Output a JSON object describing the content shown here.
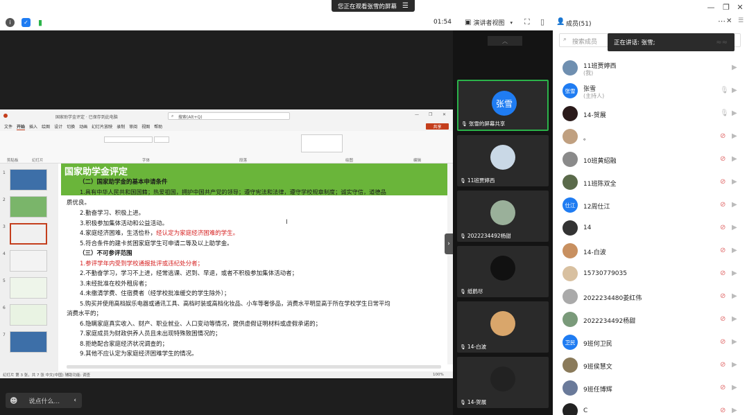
{
  "banner": {
    "text": "您正在观看张雪的屏幕",
    "menu_icon": "menu-icon"
  },
  "toolbar": {
    "time": "01:54",
    "view_label": "演讲者视图",
    "members_label": "成员(51)",
    "search_placeholder": "搜索成员"
  },
  "speaking": {
    "text": "正在讲话: 张雪;"
  },
  "chat": {
    "placeholder": "说点什么..."
  },
  "gallery": [
    {
      "name": "张雪的屏幕共享",
      "avatar_text": "张雪",
      "color": "#1f7cf2",
      "highlight": true
    },
    {
      "name": "11班贾婷西"
    },
    {
      "name": "2022234492杨甜"
    },
    {
      "name": "纸鹤尽"
    },
    {
      "name": "14-白波"
    },
    {
      "name": "14-贺展"
    }
  ],
  "ppt": {
    "doc_title": "国家助学金评定 · 已保存到此电脑",
    "search": "搜索(Alt+Q)",
    "share_btn": "共享",
    "tabs": [
      "文件",
      "开始",
      "插入",
      "绘图",
      "设计",
      "切换",
      "动画",
      "幻灯片放映",
      "录制",
      "审阅",
      "视图",
      "帮助"
    ],
    "groups": [
      "剪贴板",
      "幻灯片",
      "字体",
      "段落",
      "绘图",
      "编辑"
    ],
    "slide_title": "国家助学金评定",
    "sec1": "（二）国家助学金的基本申请条件",
    "l1a": "1.具有中华人民共和国国籍；热爱祖国，拥护中国共产党的领导；遵守宪法和法律，遵守学校规章制度；诚实守信，道德品",
    "l1b": "质优良。",
    "l2": "2.勤奋学习、积极上进。",
    "l3": "3.积极参加集体活动和公益活动。",
    "l4a": "4.家庭经济困难，生活俭朴，",
    "l4b": "经认定为家庭经济困难的学生。",
    "l5": "5.符合条件的建卡贫困家庭学生可申请二等及以上助学金。",
    "sec2": "（三）不可参评范围",
    "n1": "1.参评学年内受到学校通报批评或违纪处分者；",
    "n2": "2.不勤奋学习，学习不上进，经常逃课、迟到、早退，或者不积极参加集体活动者；",
    "n3": "3.未经批准在校外租房者；",
    "n4": "4.未缴清学费、住宿费者（经学校批准缓交的学生除外）；",
    "n5a": "5.购买并使用高档娱乐电器或通讯工具、高档时装或高档化妆品、小车等奢侈品，消费水平明显高于所在学校学生日常平均",
    "n5b": "消费水平的；",
    "n6": "6.隐瞒家庭真实收入、财产、职业就业、人口变动等情况，提供虚假证明材料或虚假承诺的；",
    "n7": "7.家庭成员为财政供养人员且未出现特殊致困情况的；",
    "n8": "8.拒绝配合家庭经济状况调查的；",
    "n9": "9.其他不应认定为家庭经济困难学生的情况。",
    "status": "幻灯片 第 3 张，共 7 张    中文(中国)    辅助功能: 调查",
    "zoom": "100%",
    "thumb_nums": [
      "1",
      "2",
      "3",
      "4",
      "5",
      "6",
      "7"
    ]
  },
  "members": [
    {
      "name": "11班贾婷西",
      "sub": "(我)",
      "avatar": "",
      "color": "#6f8fb0",
      "mic": "none"
    },
    {
      "name": "张雪",
      "sub": "(主持人)",
      "avatar": "张雪",
      "color": "#1f7cf2",
      "mic": "on"
    },
    {
      "name": "14-贺展",
      "sub": "",
      "avatar": "",
      "color": "#2a1a1a",
      "mic": "on"
    },
    {
      "name": "。",
      "sub": "",
      "avatar": "",
      "color": "#c0a080",
      "mic": "off"
    },
    {
      "name": "10班黄绍融",
      "sub": "",
      "avatar": "",
      "color": "#8a8a8a",
      "mic": "off"
    },
    {
      "name": "11班陈双全",
      "sub": "",
      "avatar": "",
      "color": "#5a6a4a",
      "mic": "off"
    },
    {
      "name": "12周仕江",
      "sub": "",
      "avatar": "仕江",
      "color": "#1f7cf2",
      "mic": "off"
    },
    {
      "name": "14",
      "sub": "",
      "avatar": "",
      "color": "#333",
      "mic": "off"
    },
    {
      "name": "14-白波",
      "sub": "",
      "avatar": "",
      "color": "#c89060",
      "mic": "off"
    },
    {
      "name": "15730779035",
      "sub": "",
      "avatar": "",
      "color": "#d8c0a0",
      "mic": "off"
    },
    {
      "name": "2022234480姜红伟",
      "sub": "",
      "avatar": "",
      "color": "#aaa",
      "mic": "off"
    },
    {
      "name": "2022234492杨甜",
      "sub": "",
      "avatar": "",
      "color": "#7a9a7a",
      "mic": "off"
    },
    {
      "name": "9班何卫民",
      "sub": "",
      "avatar": "卫民",
      "color": "#1f7cf2",
      "mic": "off"
    },
    {
      "name": "9班侯慧文",
      "sub": "",
      "avatar": "",
      "color": "#8a7a5a",
      "mic": "off"
    },
    {
      "name": "9班任博辉",
      "sub": "",
      "avatar": "",
      "color": "#6a7a9a",
      "mic": "off"
    },
    {
      "name": "C",
      "sub": "",
      "avatar": "",
      "color": "#222",
      "mic": "off"
    }
  ]
}
